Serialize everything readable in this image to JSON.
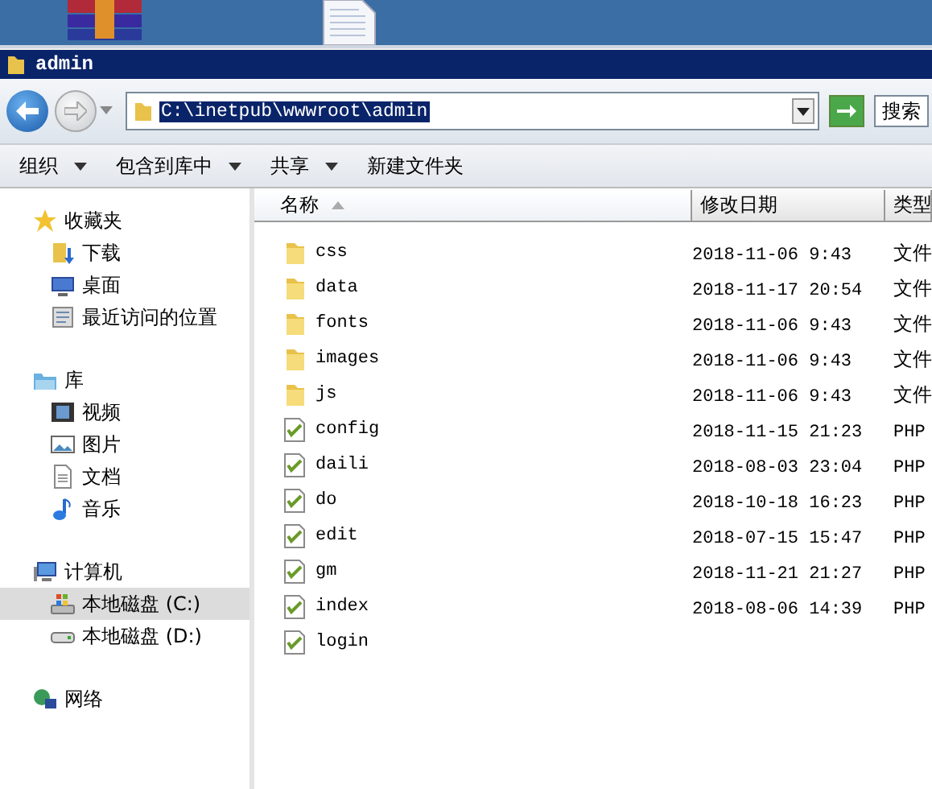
{
  "window": {
    "title": "admin"
  },
  "address": {
    "path": "C:\\inetpub\\wwwroot\\admin",
    "path_selected": true
  },
  "search": {
    "placeholder": "搜索"
  },
  "toolbar": [
    {
      "label": "组织",
      "menu": true
    },
    {
      "label": "包含到库中",
      "menu": true
    },
    {
      "label": "共享",
      "menu": true
    },
    {
      "label": "新建文件夹",
      "menu": false
    }
  ],
  "sidebar": {
    "groups": [
      {
        "label": "收藏夹",
        "kind": "star",
        "selected": false,
        "children": [
          {
            "label": "下载",
            "kind": "download",
            "selected": false
          },
          {
            "label": "桌面",
            "kind": "desktop",
            "selected": false
          },
          {
            "label": "最近访问的位置",
            "kind": "recent",
            "selected": false
          }
        ]
      },
      {
        "label": "库",
        "kind": "library",
        "selected": false,
        "children": [
          {
            "label": "视频",
            "kind": "video",
            "selected": false
          },
          {
            "label": "图片",
            "kind": "picture",
            "selected": false
          },
          {
            "label": "文档",
            "kind": "document",
            "selected": false
          },
          {
            "label": "音乐",
            "kind": "music",
            "selected": false
          }
        ]
      },
      {
        "label": "计算机",
        "kind": "computer",
        "selected": false,
        "children": [
          {
            "label": "本地磁盘 (C:)",
            "kind": "system-drive",
            "selected": true
          },
          {
            "label": "本地磁盘 (D:)",
            "kind": "drive",
            "selected": false
          }
        ]
      },
      {
        "label": "网络",
        "kind": "network",
        "selected": false
      }
    ]
  },
  "table": {
    "columns": [
      {
        "label": "名称",
        "sorted": true
      },
      {
        "label": "修改日期",
        "sorted": false
      },
      {
        "label": "类型",
        "sorted": false
      }
    ],
    "rows": [
      {
        "name": "css",
        "kind": "folder",
        "modified": "2018-11-06 9:43",
        "type": "文件"
      },
      {
        "name": "data",
        "kind": "folder",
        "modified": "2018-11-17 20:54",
        "type": "文件"
      },
      {
        "name": "fonts",
        "kind": "folder",
        "modified": "2018-11-06 9:43",
        "type": "文件"
      },
      {
        "name": "images",
        "kind": "folder",
        "modified": "2018-11-06 9:43",
        "type": "文件"
      },
      {
        "name": "js",
        "kind": "folder",
        "modified": "2018-11-06 9:43",
        "type": "文件"
      },
      {
        "name": "config",
        "kind": "php",
        "modified": "2018-11-15 21:23",
        "type": "PHP"
      },
      {
        "name": "daili",
        "kind": "php",
        "modified": "2018-08-03 23:04",
        "type": "PHP"
      },
      {
        "name": "do",
        "kind": "php",
        "modified": "2018-10-18 16:23",
        "type": "PHP"
      },
      {
        "name": "edit",
        "kind": "php",
        "modified": "2018-07-15 15:47",
        "type": "PHP"
      },
      {
        "name": "gm",
        "kind": "php",
        "modified": "2018-11-21 21:27",
        "type": "PHP"
      },
      {
        "name": "index",
        "kind": "php",
        "modified": "2018-08-06 14:39",
        "type": "PHP"
      },
      {
        "name": "login",
        "kind": "php"
      }
    ]
  }
}
